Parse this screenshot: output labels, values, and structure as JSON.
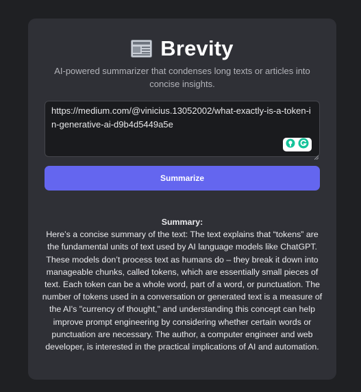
{
  "app": {
    "title": "Brevity",
    "subtitle": "AI-powered summarizer that condenses long texts or articles into concise insights.",
    "logo_icon": "newspaper-icon"
  },
  "input": {
    "value": "https://medium.com/@vinicius.13052002/what-exactly-is-a-token-in-generative-ai-d9b4d5449a5e",
    "extension_icons": [
      "assistant-icon",
      "grammarly-icon"
    ]
  },
  "actions": {
    "summarize_label": "Summarize"
  },
  "summary": {
    "heading": "Summary:",
    "body": "Here’s a concise summary of the text: The text explains that “tokens” are the fundamental units of text used by AI language models like ChatGPT. These models don’t process text as humans do – they break it down into manageable chunks, called tokens, which are essentially small pieces of text. Each token can be a whole word, part of a word, or punctuation. The number of tokens used in a conversation or generated text is a measure of the AI's \"currency of thought,\" and understanding this concept can help improve prompt engineering by considering whether certain words or punctuation are necessary. The author, a computer engineer and web developer, is interested in the practical implications of AI and automation."
  },
  "colors": {
    "background": "#1f2023",
    "card": "#2f3036",
    "accent": "#6466ef",
    "grammarly": "#15c39a"
  }
}
